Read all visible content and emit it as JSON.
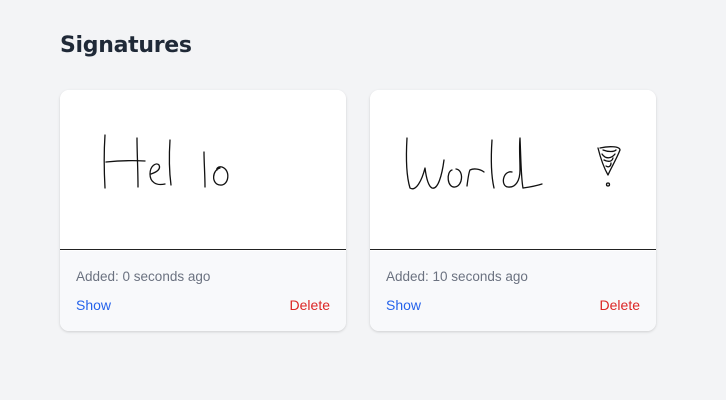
{
  "page": {
    "title": "Signatures"
  },
  "signatures": [
    {
      "added": "Added: 0 seconds ago",
      "show_label": "Show",
      "delete_label": "Delete",
      "signature_text": "Hello"
    },
    {
      "added": "Added: 10 seconds ago",
      "show_label": "Show",
      "delete_label": "Delete",
      "signature_text": "World!"
    }
  ],
  "colors": {
    "background": "#f3f4f6",
    "show_link": "#2563eb",
    "delete_link": "#dc2626",
    "muted_text": "#6b7280"
  }
}
